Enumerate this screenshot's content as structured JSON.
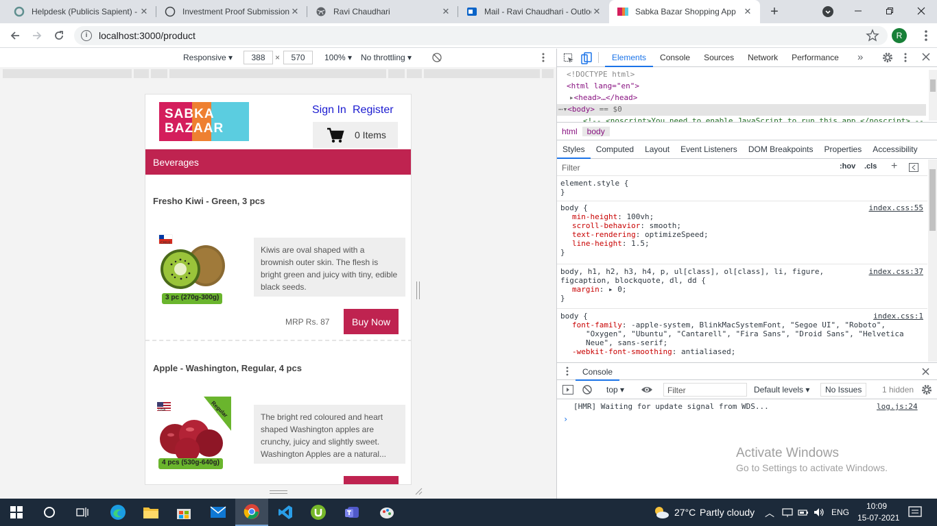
{
  "browser": {
    "tabs": [
      {
        "title": "Helpdesk (Publicis Sapient) - F",
        "icon": "helpdesk-icon"
      },
      {
        "title": "Investment Proof Submission",
        "icon": "circle-icon"
      },
      {
        "title": "Ravi Chaudhari",
        "icon": "globe-icon"
      },
      {
        "title": "Mail - Ravi Chaudhari - Outloo",
        "icon": "outlook-icon"
      },
      {
        "title": "Sabka Bazar Shopping App",
        "icon": "sabka-bazaar-icon"
      }
    ],
    "url": "localhost:3000/product",
    "profile_initial": "R"
  },
  "device_toolbar": {
    "mode": "Responsive",
    "width": "388",
    "height": "570",
    "zoom": "100%",
    "throttling": "No throttling"
  },
  "app": {
    "logo_text_line1": "SABKA",
    "logo_text_line2": "BAZAAR",
    "sign_in": "Sign In",
    "register": "Register",
    "cart_count": "0 Items",
    "category": "Beverages",
    "products": [
      {
        "name": "Fresho Kiwi - Green, 3 pcs",
        "description": "Kiwis are oval shaped with a brownish outer skin. The flesh is bright green and juicy with tiny, edible black seeds.",
        "price": "MRP Rs. 87",
        "buy_label": "Buy Now",
        "weight_badge": "3 pc (270g-300g)",
        "origin": "CHILE"
      },
      {
        "name": "Apple - Washington, Regular, 4 pcs",
        "description": "The bright red coloured and heart shaped Washington apples are crunchy, juicy and slightly sweet. Washington Apples are a natural...",
        "weight_badge": "4 pcs (530g-640g)",
        "ribbon": "Regular",
        "origin": "USA"
      }
    ]
  },
  "devtools": {
    "tabs": [
      "Elements",
      "Console",
      "Sources",
      "Network",
      "Performance"
    ],
    "dom": {
      "doctype": "<!DOCTYPE html>",
      "html_open": "<html lang=\"en\">",
      "head": "<head>…</head>",
      "body": "<body>",
      "body_suffix": "== $0",
      "noscript": "<!-- <noscript>You need to enable JavaScript to run this app.</noscript> --"
    },
    "breadcrumb": [
      "html",
      "body"
    ],
    "style_tabs": [
      "Styles",
      "Computed",
      "Layout",
      "Event Listeners",
      "DOM Breakpoints",
      "Properties",
      "Accessibility"
    ],
    "filter_placeholder": "Filter",
    "hov": ":hov",
    "cls": ".cls",
    "element_style": "element.style {",
    "rules": [
      {
        "selector": "body {",
        "source": "index.css:55",
        "props": [
          {
            "name": "min-height",
            "value": "100vh;"
          },
          {
            "name": "scroll-behavior",
            "value": "smooth;"
          },
          {
            "name": "text-rendering",
            "value": "optimizeSpeed;"
          },
          {
            "name": "line-height",
            "value": "1.5;"
          }
        ]
      },
      {
        "selector_line1": "body, h1, h2, h3, h4, p, ul[class], ol[class], li, figure,",
        "selector_line2": "figcaption, blockquote, dl, dd {",
        "source": "index.css:37",
        "props": [
          {
            "name": "margin",
            "value": "0;"
          }
        ]
      },
      {
        "selector": "body {",
        "source": "index.css:1",
        "props": [
          {
            "name": "font-family",
            "value": "-apple-system, BlinkMacSystemFont, \"Segoe UI\", \"Roboto\","
          },
          {
            "name": "",
            "value": "\"Oxygen\", \"Ubuntu\", \"Cantarell\", \"Fira Sans\", \"Droid Sans\", \"Helvetica"
          },
          {
            "name": "",
            "value": "Neue\", sans-serif;"
          },
          {
            "name": "-webkit-font-smoothing",
            "value": "antialiased;"
          }
        ]
      }
    ],
    "console": {
      "title": "Console",
      "context": "top",
      "filter_placeholder": "Filter",
      "levels": "Default levels",
      "issues": "No Issues",
      "hidden": "1 hidden",
      "message": "[HMR] Waiting for update signal from WDS...",
      "message_source": "log.js:24"
    }
  },
  "watermark": {
    "line1": "Activate Windows",
    "line2": "Go to Settings to activate Windows."
  },
  "taskbar": {
    "weather_temp": "27°C",
    "weather_text": "Partly cloudy",
    "language": "ENG",
    "time": "10:09",
    "date": "15-07-2021"
  }
}
